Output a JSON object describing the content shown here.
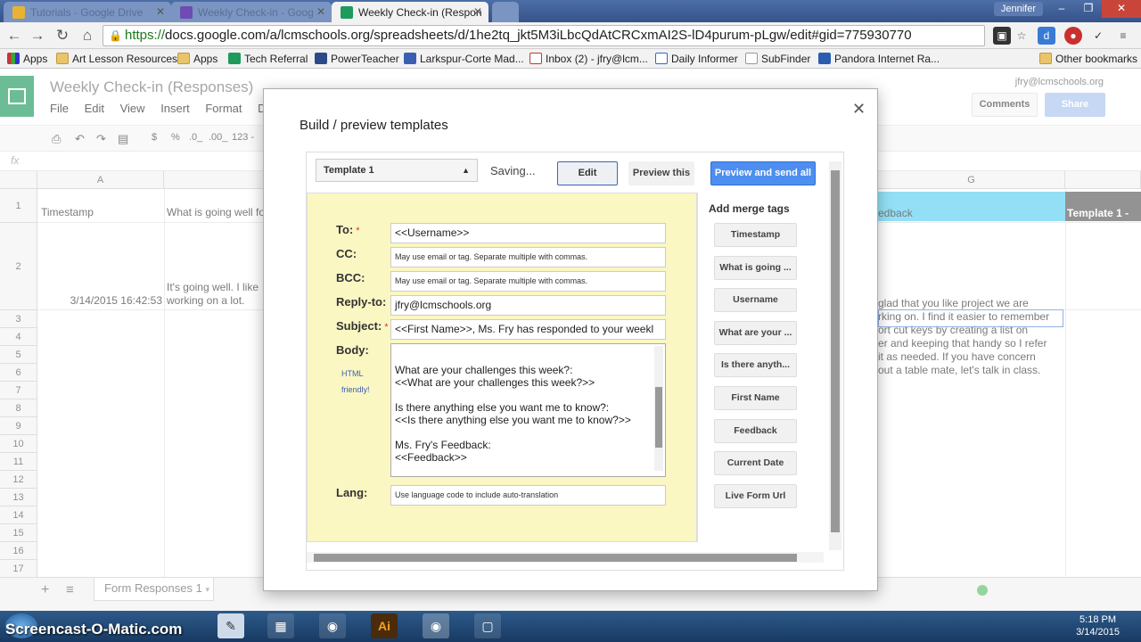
{
  "browser": {
    "tabs": [
      {
        "title": "Tutorials - Google Drive"
      },
      {
        "title": "Weekly Check-in - Goog"
      },
      {
        "title": "Weekly Check-in (Respon"
      }
    ],
    "profile_name": "Jennifer",
    "url_scheme": "https://",
    "url_rest": "docs.google.com/a/lcmschools.org/spreadsheets/d/1he2tq_jkt5M3iLbcQdAtCRCxmAI2S-lD4purum-pLgw/edit#gid=775930770",
    "bookmarks": [
      {
        "label": "Apps"
      },
      {
        "label": "Art Lesson Resources"
      },
      {
        "label": "Apps"
      },
      {
        "label": "Tech Referral"
      },
      {
        "label": "PowerTeacher"
      },
      {
        "label": "Larkspur-Corte Mad..."
      },
      {
        "label": "Inbox (2) - jfry@lcm..."
      },
      {
        "label": "Daily Informer"
      },
      {
        "label": "SubFinder"
      },
      {
        "label": "Pandora Internet Ra..."
      },
      {
        "label": "Other bookmarks"
      }
    ]
  },
  "sheets": {
    "doc_title": "Weekly Check-in (Responses)",
    "user_email": "jfry@lcmschools.org",
    "menus": [
      "File",
      "Edit",
      "View",
      "Insert",
      "Format",
      "Data"
    ],
    "comments_label": "Comments",
    "share_label": "Share",
    "fx": "fx",
    "format_items": [
      "$",
      "%",
      ".0_",
      ".00_",
      "123 -"
    ],
    "columns": [
      "A",
      "B",
      "G"
    ],
    "rows": [
      "1",
      "2",
      "3",
      "4",
      "5",
      "6",
      "7",
      "8",
      "9",
      "10",
      "11",
      "12",
      "13",
      "14",
      "15",
      "16",
      "17"
    ],
    "header_a": "Timestamp",
    "header_b": "What is going well fo",
    "header_f": "edback",
    "header_g": "Template 1 -",
    "row2_timestamp": "3/14/2015 16:42:53",
    "row2_b_line1": "It's going well. I like",
    "row2_b_line2": "working on a lot.",
    "row2_f_lines": [
      "glad that you like project we are",
      "rking on. I find it easier to remember",
      "ort cut keys by creating a list on",
      "er and keeping that handy so I refer",
      "it as needed. If you have concern",
      "out a table mate, let's talk in class."
    ],
    "sheet_tab": "Form Responses 1"
  },
  "dialog": {
    "title": "Build / preview templates",
    "template_selected": "Template 1",
    "status": "Saving...",
    "edit_label": "Edit",
    "preview_label": "Preview this",
    "send_label": "Preview and send all",
    "fields": {
      "to_label": "To:",
      "to_value": "<<Username>>",
      "cc_label": "CC:",
      "cc_placeholder": "May use email or tag. Separate multiple with commas.",
      "bcc_label": "BCC:",
      "bcc_placeholder": "May use email or tag. Separate multiple with commas.",
      "replyto_label": "Reply-to:",
      "replyto_value": "jfry@lcmschools.org",
      "subject_label": "Subject:",
      "subject_value": "<<First Name>>, Ms. Fry has responded to your weekl",
      "body_label": "Body:",
      "body_note1": "HTML",
      "body_note2": "friendly!",
      "body_text": "What are your challenges this week?:\n<<What are your challenges this week?>>\n\nIs there anything else you want me to know?:\n<<Is there anything else you want me to know?>>\n\nMs. Fry's Feedback:\n<<Feedback>>\n\nThis week, your self-portrait |",
      "lang_label": "Lang:",
      "lang_placeholder": "Use language code to include auto-translation",
      "required_mark": "*"
    },
    "merge_title": "Add merge tags",
    "merge_tags": [
      "Timestamp",
      "What is going ...",
      "Username",
      "What are your ...",
      "Is there anyth...",
      "First Name",
      "Feedback",
      "Current Date",
      "Live Form Url"
    ]
  },
  "taskbar": {
    "time": "5:18 PM",
    "date": "3/14/2015",
    "watermark": "Screencast-O-Matic.com"
  },
  "colors": {
    "accent_blue": "#4d8ef0",
    "editor_yellow": "#fbf7c3",
    "sheets_green": "#1e9a5d",
    "header_cyan": "#5ad0f2",
    "template_col": "#5a5a5a"
  }
}
